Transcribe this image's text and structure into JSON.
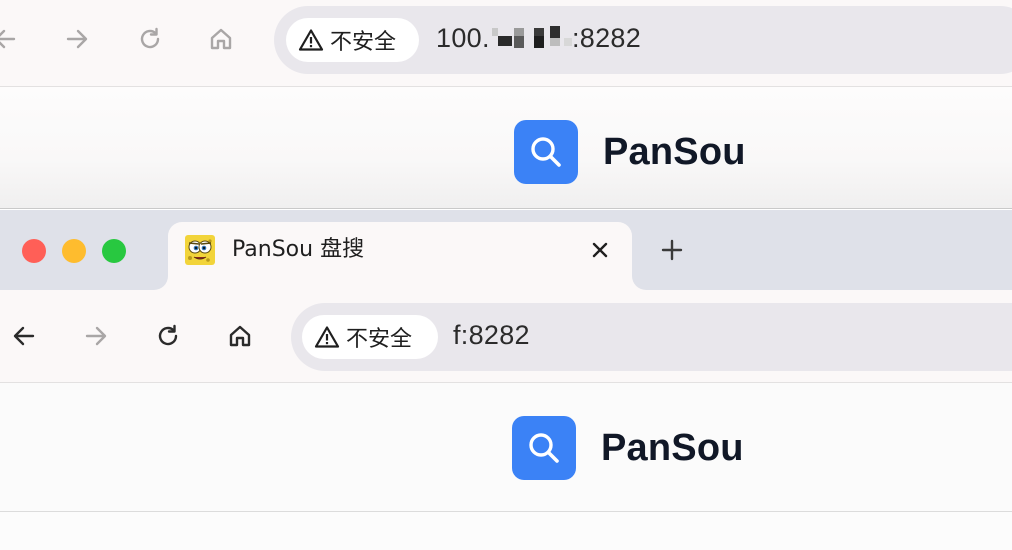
{
  "top_window": {
    "nav": {
      "back_icon": "arrow-left-icon",
      "forward_icon": "arrow-right-icon",
      "reload_icon": "reload-icon",
      "home_icon": "home-icon"
    },
    "security_label": "不安全",
    "url_prefix": "100.",
    "url_suffix": ":8282",
    "brand_name": "PanSou",
    "brand_icon": "search-icon"
  },
  "window": {
    "traffic_lights": {
      "close_color": "#ff5f57",
      "minimize_color": "#febc2e",
      "zoom_color": "#28c840"
    },
    "tab": {
      "title": "PanSou 盘搜",
      "favicon": "sponge-face-icon",
      "close_icon": "close-icon"
    },
    "new_tab_icon": "plus-icon",
    "nav": {
      "back_icon": "arrow-left-icon",
      "forward_icon": "arrow-right-icon",
      "reload_icon": "reload-icon",
      "home_icon": "home-icon"
    },
    "security_label": "不安全",
    "url": "f:8282",
    "brand_name": "PanSou",
    "brand_icon": "search-icon"
  },
  "colors": {
    "accent": "#3b82f6",
    "brand_text": "#111827",
    "tabstrip": "#dfe1e9",
    "toolbar": "#fbf8f8",
    "omnibox": "#e9e7ec"
  }
}
